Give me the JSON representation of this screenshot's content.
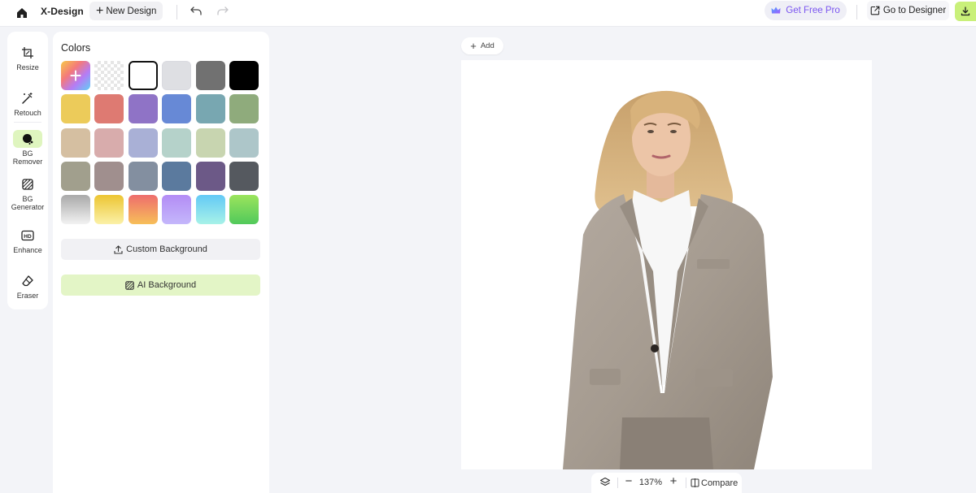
{
  "app": {
    "brand": "X-Design"
  },
  "toolbar": {
    "new_design_label": "New Design",
    "get_pro_label": "Get Free Pro",
    "go_designer_label": "Go to Designer",
    "brand_color": "#c9f07a",
    "pro_color": "#7a54f0"
  },
  "tools": [
    {
      "label": "Resize",
      "icon": "crop-icon"
    },
    {
      "label": "Retouch",
      "icon": "magic-wand-icon"
    },
    {
      "label": "BG\nRemover",
      "icon": "bg-remover-icon",
      "active": true
    },
    {
      "label": "BG\nGenerator",
      "icon": "bg-generator-icon"
    },
    {
      "label": "Enhance",
      "icon": "hd-icon"
    },
    {
      "label": "Eraser",
      "icon": "eraser-icon"
    }
  ],
  "colors_panel": {
    "title": "Colors",
    "swatches": [
      {
        "type": "add",
        "fill": "linear-gradient(135deg,#f7c948 0%,#f47a7a 35%,#b57cf5 65%,#5fd0f5 100%)"
      },
      {
        "type": "transparent"
      },
      {
        "type": "color",
        "fill": "#ffffff",
        "selected": true
      },
      {
        "type": "color",
        "fill": "#dedfe3"
      },
      {
        "type": "color",
        "fill": "#717171"
      },
      {
        "type": "color",
        "fill": "#000000"
      },
      {
        "type": "color",
        "fill": "#eccb5a"
      },
      {
        "type": "color",
        "fill": "#de7a72"
      },
      {
        "type": "color",
        "fill": "#8f73c6"
      },
      {
        "type": "color",
        "fill": "#6789d6"
      },
      {
        "type": "color",
        "fill": "#78a7b1"
      },
      {
        "type": "color",
        "fill": "#8fab7c"
      },
      {
        "type": "color",
        "fill": "#d5bfa1"
      },
      {
        "type": "color",
        "fill": "#d8acac"
      },
      {
        "type": "color",
        "fill": "#a9b0d6"
      },
      {
        "type": "color",
        "fill": "#b5d2ca"
      },
      {
        "type": "color",
        "fill": "#c8d5b0"
      },
      {
        "type": "color",
        "fill": "#adc6c9"
      },
      {
        "type": "color",
        "fill": "#a19f8d"
      },
      {
        "type": "color",
        "fill": "#a08f8e"
      },
      {
        "type": "color",
        "fill": "#838fa0"
      },
      {
        "type": "color",
        "fill": "#5b7a9e"
      },
      {
        "type": "color",
        "fill": "#6c5987"
      },
      {
        "type": "color",
        "fill": "#55595f"
      },
      {
        "type": "color",
        "fill": "linear-gradient(180deg,#a9a9a9 0%,#f2f2f2 100%)"
      },
      {
        "type": "color",
        "fill": "linear-gradient(180deg,#ecc532 0%,#fbf1a8 100%)"
      },
      {
        "type": "color",
        "fill": "linear-gradient(180deg,#ee6d6d 0%,#f7bf59 100%)"
      },
      {
        "type": "color",
        "fill": "linear-gradient(180deg,#b38cf5 0%,#c4b7fb 100%)"
      },
      {
        "type": "color",
        "fill": "linear-gradient(180deg,#63c9f6 0%,#a7f2e8 100%)"
      },
      {
        "type": "color",
        "fill": "linear-gradient(180deg,#9be45c 0%,#51c95b 100%)"
      }
    ],
    "custom_bg_label": "Custom Background",
    "ai_bg_label": "AI Background"
  },
  "canvas": {
    "add_label": "Add"
  },
  "zoom": {
    "level": "137%",
    "compare_label": "Compare"
  }
}
